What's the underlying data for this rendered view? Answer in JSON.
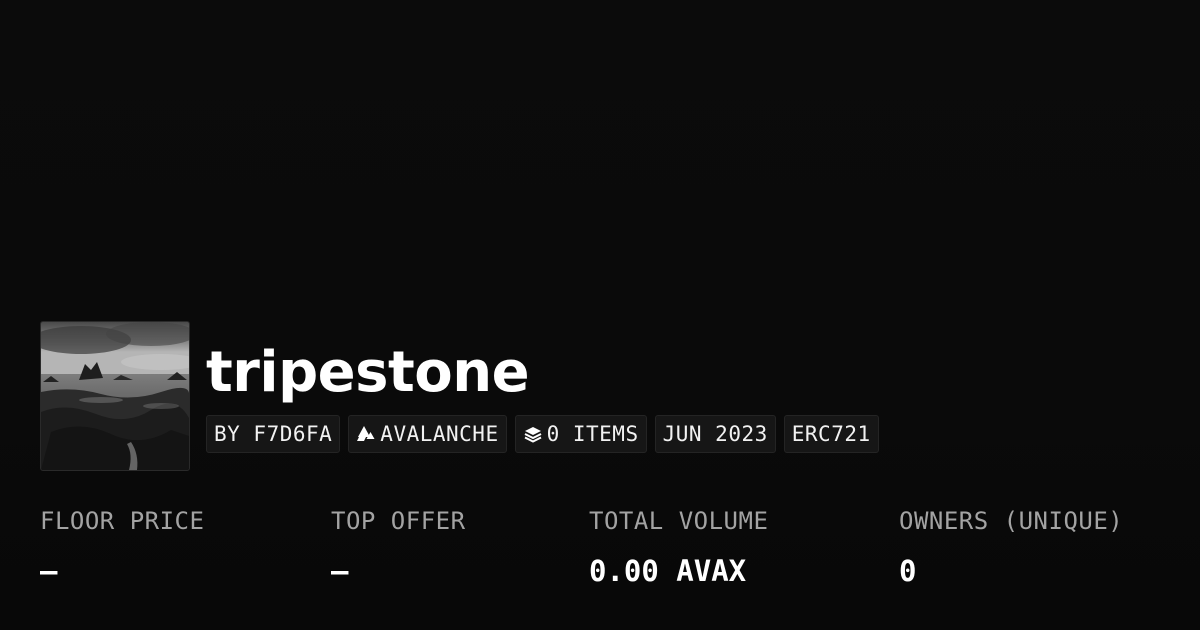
{
  "collection": {
    "name": "tripestone",
    "thumbnail_alt": "tripestone collection image"
  },
  "chips": [
    {
      "label": "BY F7D6FA",
      "icon": null
    },
    {
      "label": "AVALANCHE",
      "icon": "avalanche-icon"
    },
    {
      "label": "0 ITEMS",
      "icon": "layers-icon"
    },
    {
      "label": "JUN 2023",
      "icon": null
    },
    {
      "label": "ERC721",
      "icon": null
    }
  ],
  "stats": [
    {
      "label": "FLOOR PRICE",
      "value": "–"
    },
    {
      "label": "TOP OFFER",
      "value": "–"
    },
    {
      "label": "TOTAL VOLUME",
      "value": "0.00 AVAX"
    },
    {
      "label": "OWNERS (UNIQUE)",
      "value": "0"
    }
  ],
  "colors": {
    "background": "#0a0a0a",
    "chip_background": "#161616",
    "chip_border": "#242424",
    "label": "#a3a3a3",
    "text": "#ffffff"
  }
}
